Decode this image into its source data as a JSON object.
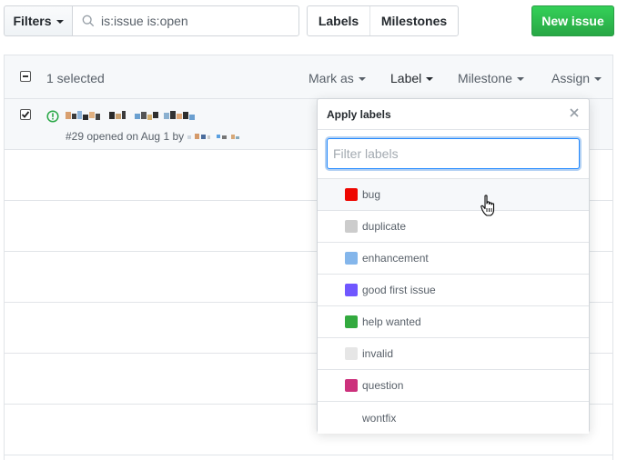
{
  "topbar": {
    "filters_label": "Filters",
    "search_value": "is:issue is:open",
    "labels_tab": "Labels",
    "milestones_tab": "Milestones",
    "new_issue_label": "New issue"
  },
  "list_header": {
    "selected_text": "1 selected",
    "mark_as": "Mark as",
    "label": "Label",
    "milestone": "Milestone",
    "assign": "Assign"
  },
  "issue": {
    "checked": true,
    "meta": "#29 opened on Aug 1 by"
  },
  "dropdown": {
    "title": "Apply labels",
    "filter_placeholder": "Filter labels",
    "labels": [
      {
        "name": "bug",
        "color": "#ee0701"
      },
      {
        "name": "duplicate",
        "color": "#cccccc"
      },
      {
        "name": "enhancement",
        "color": "#84b6eb"
      },
      {
        "name": "good first issue",
        "color": "#7057ff"
      },
      {
        "name": "help wanted",
        "color": "#33aa3f"
      },
      {
        "name": "invalid",
        "color": "#e6e6e6"
      },
      {
        "name": "question",
        "color": "#cc317c"
      },
      {
        "name": "wontfix",
        "color": ""
      }
    ]
  },
  "colors": {
    "primary_green": "#28a745",
    "open_icon_green": "#28a745",
    "focus_blue": "#2188ff"
  }
}
